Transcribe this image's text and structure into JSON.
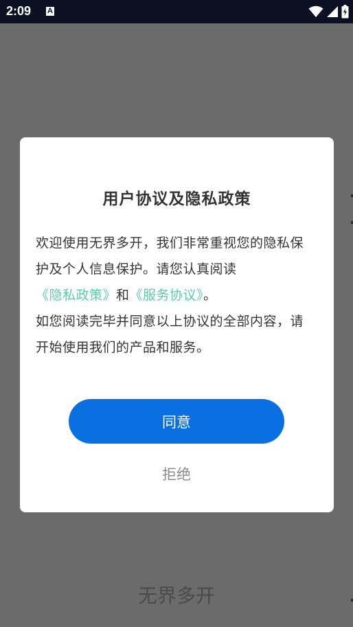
{
  "status_bar": {
    "time": "2:09",
    "notification_icon": "A",
    "icons": [
      "wifi-icon",
      "signal-icon",
      "battery-icon"
    ]
  },
  "background": {
    "app_name": "无界多开"
  },
  "dialog": {
    "title": "用户协议及隐私政策",
    "body_intro": "欢迎使用无界多开，我们非常重视您的隐私保护及个人信息保护。请您认真阅读",
    "privacy_link": "《隐私政策》",
    "and_text": "和",
    "service_link": "《服务协议》",
    "period": "。",
    "body_outro": "如您阅读完毕并同意以上协议的全部内容，请开始使用我们的产品和服务。",
    "agree_label": "同意",
    "reject_label": "拒绝"
  },
  "colors": {
    "overlay": "#6b6b6b",
    "status_bar": "#0b1022",
    "primary": "#0a6fe0",
    "link": "#5fc9a8"
  }
}
